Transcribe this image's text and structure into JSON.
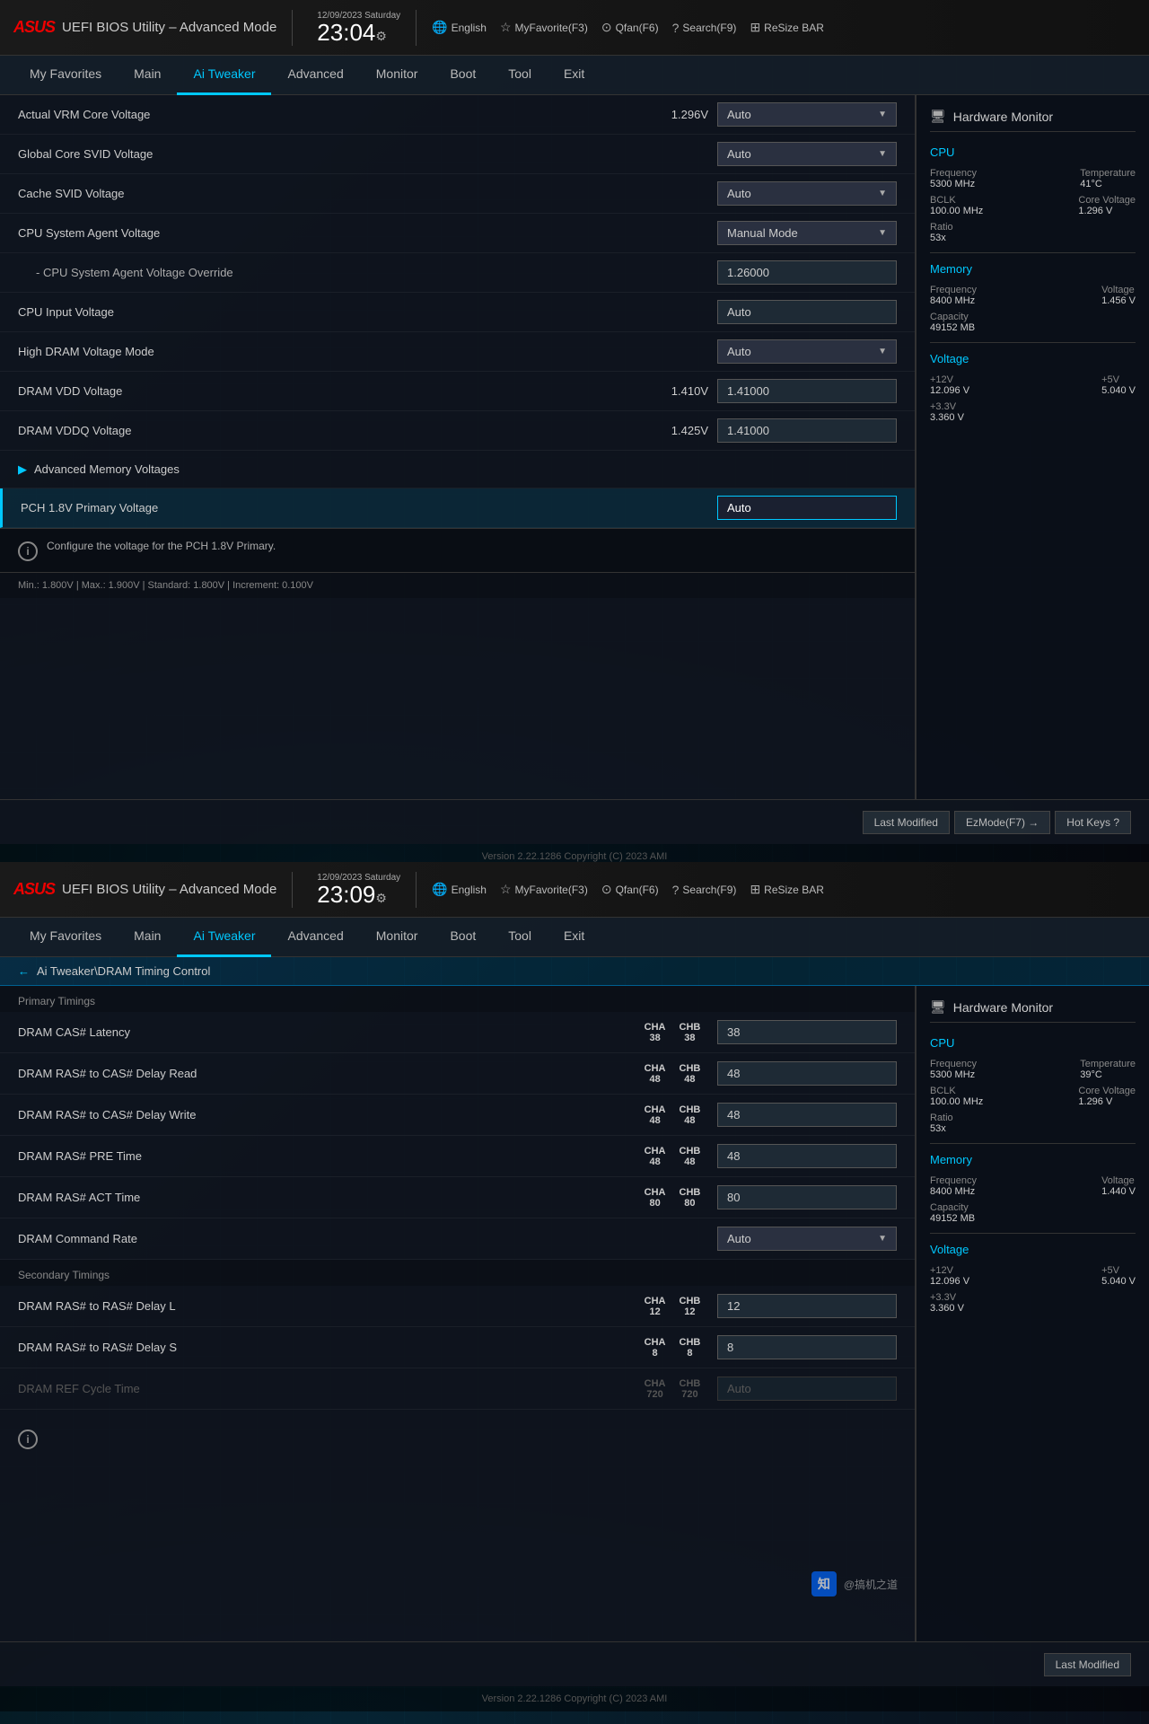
{
  "panel1": {
    "logo": "ASUS",
    "title": "UEFI BIOS Utility – Advanced Mode",
    "date": "12/09/2023 Saturday",
    "time": "23:04",
    "topbar": {
      "english": "English",
      "myfavorite": "MyFavorite(F3)",
      "qfan": "Qfan(F6)",
      "search": "Search(F9)",
      "resizebar": "ReSize BAR"
    },
    "nav": {
      "items": [
        "My Favorites",
        "Main",
        "Ai Tweaker",
        "Advanced",
        "Monitor",
        "Boot",
        "Tool",
        "Exit"
      ],
      "active": "Ai Tweaker"
    },
    "settings": [
      {
        "label": "Actual VRM Core Voltage",
        "value": "1.296V",
        "control": "dropdown",
        "control_value": "Auto"
      },
      {
        "label": "Global Core SVID Voltage",
        "value": "",
        "control": "dropdown",
        "control_value": "Auto"
      },
      {
        "label": "Cache SVID Voltage",
        "value": "",
        "control": "dropdown",
        "control_value": "Auto"
      },
      {
        "label": "CPU System Agent Voltage",
        "value": "",
        "control": "dropdown",
        "control_value": "Manual Mode"
      },
      {
        "label": "- CPU System Agent Voltage Override",
        "value": "",
        "control": "text",
        "control_value": "1.26000",
        "sub": true
      },
      {
        "label": "CPU Input Voltage",
        "value": "",
        "control": "text",
        "control_value": "Auto"
      },
      {
        "label": "High DRAM Voltage Mode",
        "value": "",
        "control": "dropdown",
        "control_value": "Auto"
      },
      {
        "label": "DRAM VDD Voltage",
        "value": "1.410V",
        "control": "text",
        "control_value": "1.41000"
      },
      {
        "label": "DRAM VDDQ Voltage",
        "value": "1.425V",
        "control": "text",
        "control_value": "1.41000"
      },
      {
        "label": "Advanced Memory Voltages",
        "expandable": true
      },
      {
        "label": "PCH 1.8V Primary Voltage",
        "value": "",
        "control": "text",
        "control_value": "Auto",
        "highlighted": true
      }
    ],
    "info": "Configure the voltage for the PCH 1.8V Primary.",
    "spec": "Min.: 1.800V  |  Max.: 1.900V  |  Standard: 1.800V  |  Increment: 0.100V",
    "bottom_buttons": [
      "Last Modified",
      "EzMode(F7) →",
      "Hot Keys ?"
    ],
    "version": "Version 2.22.1286 Copyright (C) 2023 AMI"
  },
  "hw_monitor_1": {
    "title": "Hardware Monitor",
    "cpu": {
      "section": "CPU",
      "frequency_label": "Frequency",
      "frequency_value": "5300 MHz",
      "temperature_label": "Temperature",
      "temperature_value": "41°C",
      "bclk_label": "BCLK",
      "bclk_value": "100.00 MHz",
      "core_voltage_label": "Core Voltage",
      "core_voltage_value": "1.296 V",
      "ratio_label": "Ratio",
      "ratio_value": "53x"
    },
    "memory": {
      "section": "Memory",
      "frequency_label": "Frequency",
      "frequency_value": "8400 MHz",
      "voltage_label": "Voltage",
      "voltage_value": "1.456 V",
      "capacity_label": "Capacity",
      "capacity_value": "49152 MB"
    },
    "voltage": {
      "section": "Voltage",
      "v12_label": "+12V",
      "v12_value": "12.096 V",
      "v5_label": "+5V",
      "v5_value": "5.040 V",
      "v33_label": "+3.3V",
      "v33_value": "3.360 V"
    }
  },
  "panel2": {
    "logo": "ASUS",
    "title": "UEFI BIOS Utility – Advanced Mode",
    "date": "12/09/2023 Saturday",
    "time": "23:09",
    "topbar": {
      "english": "English",
      "myfavorite": "MyFavorite(F3)",
      "qfan": "Qfan(F6)",
      "search": "Search(F9)",
      "resizebar": "ReSize BAR"
    },
    "nav": {
      "items": [
        "My Favorites",
        "Main",
        "Ai Tweaker",
        "Advanced",
        "Monitor",
        "Boot",
        "Tool",
        "Exit"
      ],
      "active": "Ai Tweaker"
    },
    "breadcrumb": "Ai Tweaker\\DRAM Timing Control",
    "sections": {
      "primary": "Primary Timings",
      "secondary": "Secondary Timings"
    },
    "dram_settings": [
      {
        "label": "DRAM CAS# Latency",
        "cha": "38",
        "chb": "38",
        "value": "38",
        "section": "primary"
      },
      {
        "label": "DRAM RAS# to CAS# Delay Read",
        "cha": "48",
        "chb": "48",
        "value": "48",
        "section": "primary"
      },
      {
        "label": "DRAM RAS# to CAS# Delay Write",
        "cha": "48",
        "chb": "48",
        "value": "48",
        "section": "primary"
      },
      {
        "label": "DRAM RAS# PRE Time",
        "cha": "48",
        "chb": "48",
        "value": "48",
        "section": "primary"
      },
      {
        "label": "DRAM RAS# ACT Time",
        "cha": "80",
        "chb": "80",
        "value": "80",
        "section": "primary"
      },
      {
        "label": "DRAM Command Rate",
        "cha": "",
        "chb": "",
        "value": "",
        "control": "dropdown",
        "control_value": "Auto",
        "section": "primary"
      },
      {
        "label": "DRAM RAS# to RAS# Delay L",
        "cha": "12",
        "chb": "12",
        "value": "12",
        "section": "secondary"
      },
      {
        "label": "DRAM RAS# to RAS# Delay S",
        "cha": "8",
        "chb": "8",
        "value": "8",
        "section": "secondary"
      },
      {
        "label": "DRAM REF Cycle Time",
        "cha": "720",
        "chb": "720",
        "value": "",
        "control": "dropdown",
        "control_value": "Auto",
        "disabled": true,
        "section": "secondary"
      }
    ],
    "bottom_buttons": [
      "Last Modified"
    ],
    "version": "Version 2.22.1286 Copyright (C) 2023 AMI"
  },
  "hw_monitor_2": {
    "title": "Hardware Monitor",
    "cpu": {
      "section": "CPU",
      "frequency_label": "Frequency",
      "frequency_value": "5300 MHz",
      "temperature_label": "Temperature",
      "temperature_value": "39°C",
      "bclk_label": "BCLK",
      "bclk_value": "100.00 MHz",
      "core_voltage_label": "Core Voltage",
      "core_voltage_value": "1.296 V",
      "ratio_label": "Ratio",
      "ratio_value": "53x"
    },
    "memory": {
      "section": "Memory",
      "frequency_label": "Frequency",
      "frequency_value": "8400 MHz",
      "voltage_label": "Voltage",
      "voltage_value": "1.440 V",
      "capacity_label": "Capacity",
      "capacity_value": "49152 MB"
    },
    "voltage": {
      "section": "Voltage",
      "v12_label": "+12V",
      "v12_value": "12.096 V",
      "v5_label": "+5V",
      "v5_value": "5.040 V",
      "v33_label": "+3.3V",
      "v33_value": "3.360 V"
    }
  },
  "watermark": {
    "icon": "知",
    "text": "@搞机之道"
  }
}
